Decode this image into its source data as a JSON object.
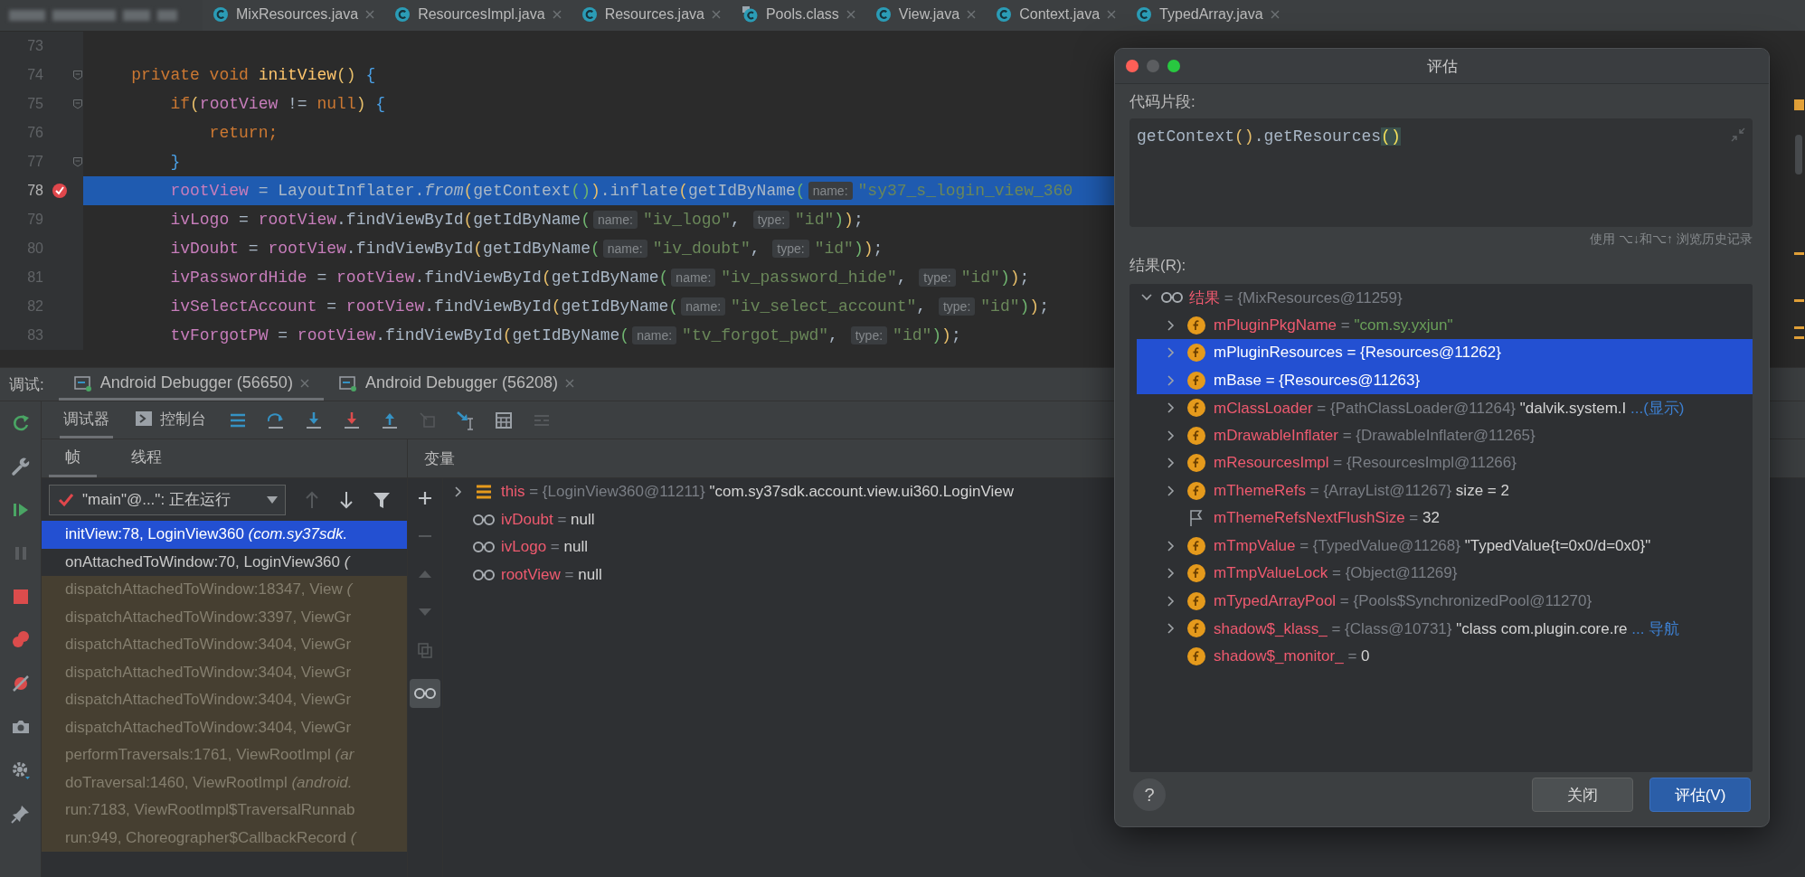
{
  "tabs": [
    {
      "label": "MixResources.java",
      "kind": "java",
      "selected": false
    },
    {
      "label": "ResourcesImpl.java",
      "kind": "java",
      "selected": false
    },
    {
      "label": "Resources.java",
      "kind": "java",
      "selected": false
    },
    {
      "label": "Pools.class",
      "kind": "class",
      "selected": false
    },
    {
      "label": "View.java",
      "kind": "java",
      "selected": false
    },
    {
      "label": "Context.java",
      "kind": "java",
      "selected": false
    },
    {
      "label": "TypedArray.java",
      "kind": "java",
      "selected": false
    }
  ],
  "editor": {
    "lines": [
      {
        "number": "73",
        "selected": false,
        "breakpoint": false,
        "fold": false
      },
      {
        "number": "74",
        "selected": false,
        "breakpoint": false,
        "fold": true,
        "tokens": [
          {
            "text": "    private void ",
            "kind": "keyword"
          },
          {
            "text": "initView",
            "kind": "method"
          },
          {
            "text": "() ",
            "kind": "paren"
          },
          {
            "text": "{",
            "kind": "brace"
          }
        ]
      },
      {
        "number": "75",
        "selected": false,
        "breakpoint": false,
        "fold": true,
        "tokens": [
          {
            "text": "        if",
            "kind": "keyword"
          },
          {
            "text": "(",
            "kind": "paren"
          },
          {
            "text": "rootView",
            "kind": "field"
          },
          {
            "text": " != ",
            "kind": "plain"
          },
          {
            "text": "null",
            "kind": "keyword"
          },
          {
            "text": ") ",
            "kind": "paren"
          },
          {
            "text": "{",
            "kind": "brace"
          }
        ]
      },
      {
        "number": "76",
        "selected": false,
        "breakpoint": false,
        "fold": false,
        "tokens": [
          {
            "text": "            return;",
            "kind": "keyword"
          }
        ]
      },
      {
        "number": "77",
        "selected": false,
        "breakpoint": false,
        "fold": true,
        "tokens": [
          {
            "text": "        }",
            "kind": "brace"
          }
        ]
      },
      {
        "number": "78",
        "selected": true,
        "breakpoint": true,
        "fold": false,
        "tokens": [
          {
            "text": "        rootView",
            "kind": "field"
          },
          {
            "text": " = LayoutInflater.",
            "kind": "plain"
          },
          {
            "text": "from",
            "kind": "italic"
          },
          {
            "text": "(",
            "kind": "paren"
          },
          {
            "text": "getContext",
            "kind": "plain"
          },
          {
            "text": "()",
            "kind": "paren2"
          },
          {
            "text": ")",
            "kind": "paren"
          },
          {
            "text": ".inflate",
            "kind": "plain"
          },
          {
            "text": "(",
            "kind": "paren"
          },
          {
            "text": "getIdByName",
            "kind": "plain"
          },
          {
            "text": "(",
            "kind": "paren2"
          },
          {
            "text": "name:",
            "kind": "hint"
          },
          {
            "text": "\"sy37_s_login_view_360",
            "kind": "string"
          }
        ]
      },
      {
        "number": "79",
        "selected": false,
        "breakpoint": false,
        "fold": false,
        "tokens": [
          {
            "text": "        ivLogo",
            "kind": "field"
          },
          {
            "text": " = ",
            "kind": "plain"
          },
          {
            "text": "rootView",
            "kind": "field"
          },
          {
            "text": ".findViewById",
            "kind": "plain"
          },
          {
            "text": "(",
            "kind": "paren"
          },
          {
            "text": "getIdByName",
            "kind": "plain"
          },
          {
            "text": "(",
            "kind": "paren2"
          },
          {
            "text": "name:",
            "kind": "hint"
          },
          {
            "text": "\"iv_logo\"",
            "kind": "string"
          },
          {
            "text": ", ",
            "kind": "plain"
          },
          {
            "text": "type:",
            "kind": "hint"
          },
          {
            "text": "\"id\"",
            "kind": "string"
          },
          {
            "text": ")",
            "kind": "paren2"
          },
          {
            "text": ")",
            "kind": "paren"
          },
          {
            "text": ";",
            "kind": "plain"
          }
        ]
      },
      {
        "number": "80",
        "selected": false,
        "breakpoint": false,
        "fold": false,
        "tokens": [
          {
            "text": "        ivDoubt",
            "kind": "field"
          },
          {
            "text": " = ",
            "kind": "plain"
          },
          {
            "text": "rootView",
            "kind": "field"
          },
          {
            "text": ".findViewById",
            "kind": "plain"
          },
          {
            "text": "(",
            "kind": "paren"
          },
          {
            "text": "getIdByName",
            "kind": "plain"
          },
          {
            "text": "(",
            "kind": "paren2"
          },
          {
            "text": "name:",
            "kind": "hint"
          },
          {
            "text": "\"iv_doubt\"",
            "kind": "string"
          },
          {
            "text": ", ",
            "kind": "plain"
          },
          {
            "text": "type:",
            "kind": "hint"
          },
          {
            "text": "\"id\"",
            "kind": "string"
          },
          {
            "text": ")",
            "kind": "paren2"
          },
          {
            "text": ")",
            "kind": "paren"
          },
          {
            "text": ";",
            "kind": "plain"
          }
        ]
      },
      {
        "number": "81",
        "selected": false,
        "breakpoint": false,
        "fold": false,
        "tokens": [
          {
            "text": "        ivPasswordHide",
            "kind": "field"
          },
          {
            "text": " = ",
            "kind": "plain"
          },
          {
            "text": "rootView",
            "kind": "field"
          },
          {
            "text": ".findViewById",
            "kind": "plain"
          },
          {
            "text": "(",
            "kind": "paren"
          },
          {
            "text": "getIdByName",
            "kind": "plain"
          },
          {
            "text": "(",
            "kind": "paren2"
          },
          {
            "text": "name:",
            "kind": "hint"
          },
          {
            "text": "\"iv_password_hide\"",
            "kind": "string"
          },
          {
            "text": ", ",
            "kind": "plain"
          },
          {
            "text": "type:",
            "kind": "hint"
          },
          {
            "text": "\"id\"",
            "kind": "string"
          },
          {
            "text": ")",
            "kind": "paren2"
          },
          {
            "text": ")",
            "kind": "paren"
          },
          {
            "text": ";",
            "kind": "plain"
          }
        ]
      },
      {
        "number": "82",
        "selected": false,
        "breakpoint": false,
        "fold": false,
        "tokens": [
          {
            "text": "        ivSelectAccount",
            "kind": "field"
          },
          {
            "text": " = ",
            "kind": "plain"
          },
          {
            "text": "rootView",
            "kind": "field"
          },
          {
            "text": ".findViewById",
            "kind": "plain"
          },
          {
            "text": "(",
            "kind": "paren"
          },
          {
            "text": "getIdByName",
            "kind": "plain"
          },
          {
            "text": "(",
            "kind": "paren2"
          },
          {
            "text": "name:",
            "kind": "hint"
          },
          {
            "text": "\"iv_select_account\"",
            "kind": "string"
          },
          {
            "text": ", ",
            "kind": "plain"
          },
          {
            "text": "type:",
            "kind": "hint"
          },
          {
            "text": "\"id\"",
            "kind": "string"
          },
          {
            "text": ")",
            "kind": "paren2"
          },
          {
            "text": ")",
            "kind": "paren"
          },
          {
            "text": ";",
            "kind": "plain"
          }
        ]
      },
      {
        "number": "83",
        "selected": false,
        "breakpoint": false,
        "fold": false,
        "tokens": [
          {
            "text": "        tvForgotPW",
            "kind": "field"
          },
          {
            "text": " = ",
            "kind": "plain"
          },
          {
            "text": "rootView",
            "kind": "field"
          },
          {
            "text": ".findViewById",
            "kind": "plain"
          },
          {
            "text": "(",
            "kind": "paren"
          },
          {
            "text": "getIdByName",
            "kind": "plain"
          },
          {
            "text": "(",
            "kind": "paren2"
          },
          {
            "text": "name:",
            "kind": "hint"
          },
          {
            "text": "\"tv_forgot_pwd\"",
            "kind": "string"
          },
          {
            "text": ", ",
            "kind": "plain"
          },
          {
            "text": "type:",
            "kind": "hint"
          },
          {
            "text": "\"id\"",
            "kind": "string"
          },
          {
            "text": ")",
            "kind": "paren2"
          },
          {
            "text": ")",
            "kind": "paren"
          },
          {
            "text": ";",
            "kind": "plain"
          }
        ]
      }
    ]
  },
  "debug": {
    "label": "调试:",
    "sessions": [
      {
        "label": "Android Debugger (56650)",
        "selected": true
      },
      {
        "label": "Android Debugger (56208)",
        "selected": false
      }
    ],
    "views": [
      {
        "label": "调试器",
        "kind": "plain",
        "selected": true
      },
      {
        "label": "控制台",
        "kind": "console",
        "selected": false
      }
    ],
    "frame_tabs": [
      {
        "label": "帧",
        "selected": true
      },
      {
        "label": "线程",
        "selected": false
      }
    ],
    "variables_label": "变量",
    "thread": "\"main\"@...\": 正在运行",
    "frames": [
      {
        "text": "initView:78, LoginView360 ",
        "package": "(com.sy37sdk.",
        "selected": true,
        "library": false
      },
      {
        "text": "onAttachedToWindow:70, LoginView360 ",
        "package": "(",
        "selected": false,
        "library": false
      },
      {
        "text": "dispatchAttachedToWindow:18347, View ",
        "package": "(",
        "selected": false,
        "library": true
      },
      {
        "text": "dispatchAttachedToWindow:3397, ViewGr",
        "selected": false,
        "library": true
      },
      {
        "text": "dispatchAttachedToWindow:3404, ViewGr",
        "selected": false,
        "library": true
      },
      {
        "text": "dispatchAttachedToWindow:3404, ViewGr",
        "selected": false,
        "library": true
      },
      {
        "text": "dispatchAttachedToWindow:3404, ViewGr",
        "selected": false,
        "library": true
      },
      {
        "text": "dispatchAttachedToWindow:3404, ViewGr",
        "selected": false,
        "library": true
      },
      {
        "text": "performTraversals:1761, ViewRootImpl ",
        "package": "(ar",
        "selected": false,
        "library": true
      },
      {
        "text": "doTraversal:1460, ViewRootImpl ",
        "package": "(android.",
        "selected": false,
        "library": true
      },
      {
        "text": "run:7183, ViewRootImpl$TraversalRunnab",
        "selected": false,
        "library": true
      },
      {
        "text": "run:949, Choreographer$CallbackRecord ",
        "package": "(",
        "selected": false,
        "library": true
      }
    ],
    "variables": [
      {
        "name": "this",
        "ref": "= {LoginView360@11211}",
        "value": "\"com.sy37sdk.account.view.ui360.LoginView",
        "kind": "object",
        "expanded": false,
        "selected": false
      },
      {
        "name": "ivDoubt",
        "ref": "=",
        "value": "null",
        "kind": "watch",
        "selected": false
      },
      {
        "name": "ivLogo",
        "ref": "=",
        "value": "null",
        "kind": "watch",
        "selected": false
      },
      {
        "name": "rootView",
        "ref": "=",
        "value": "null",
        "kind": "watch",
        "selected": false
      }
    ]
  },
  "dialog": {
    "title": "评估",
    "snippet_label": "代码片段:",
    "code": [
      {
        "text": "getContext",
        "kind": "plain"
      },
      {
        "text": "()",
        "kind": "paren"
      },
      {
        "text": ".getResources",
        "kind": "plain"
      },
      {
        "text": "()",
        "kind": "match"
      }
    ],
    "history_hint": "使用 ⌥↓和⌥↑ 浏览历史记录",
    "result_label": "结果(R):",
    "results": [
      {
        "name": "结果",
        "ref": "= {MixResources@11259}",
        "kind": "watch",
        "expanded": true,
        "selected": false,
        "children": [
          {
            "name": "mPluginPkgName",
            "ref": "=",
            "value": {
              "text": "\"com.sy.yxjun\"",
              "kind": "string"
            },
            "kind": "field",
            "expanded": false,
            "selected": false
          },
          {
            "name": "mPluginResources",
            "ref": "= {Resources@11262}",
            "kind": "field",
            "expanded": false,
            "selected": true
          },
          {
            "name": "mBase",
            "ref": "= {Resources@11263}",
            "kind": "field",
            "expanded": false,
            "selected": true
          },
          {
            "name": "mClassLoader",
            "ref": "= {PathClassLoader@11264}",
            "value": "\"dalvik.system.I",
            "link": "...(显示)",
            "kind": "field",
            "expanded": false,
            "selected": false
          },
          {
            "name": "mDrawableInflater",
            "ref": "= {DrawableInflater@11265}",
            "kind": "field",
            "expanded": false,
            "selected": false
          },
          {
            "name": "mResourcesImpl",
            "ref": "= {ResourcesImpl@11266}",
            "kind": "field",
            "expanded": false,
            "selected": false
          },
          {
            "name": "mThemeRefs",
            "ref": "= {ArrayList@11267}",
            "value": "size = 2",
            "kind": "field",
            "expanded": false,
            "selected": false
          },
          {
            "name": "mThemeRefsNextFlushSize",
            "ref": "=",
            "value": "32",
            "kind": "flag",
            "selected": false
          },
          {
            "name": "mTmpValue",
            "ref": "= {TypedValue@11268}",
            "value": "\"TypedValue{t=0x0/d=0x0}\"",
            "kind": "field",
            "expanded": false,
            "selected": false
          },
          {
            "name": "mTmpValueLock",
            "ref": "= {Object@11269}",
            "kind": "field",
            "expanded": false,
            "selected": false
          },
          {
            "name": "mTypedArrayPool",
            "ref": "= {Pools$SynchronizedPool@11270}",
            "kind": "field",
            "expanded": false,
            "selected": false
          },
          {
            "name": "shadow$_klass_",
            "ref": "= {Class@10731}",
            "value": "\"class com.plugin.core.re",
            "link": "... 导航",
            "kind": "field",
            "expanded": false,
            "selected": false
          },
          {
            "name": "shadow$_monitor_",
            "ref": "=",
            "value": "0",
            "kind": "field",
            "selected": false
          }
        ]
      }
    ],
    "help": "?",
    "buttons": [
      {
        "label": "关闭",
        "kind": "secondary"
      },
      {
        "label": "评估(V)",
        "kind": "primary"
      }
    ]
  }
}
